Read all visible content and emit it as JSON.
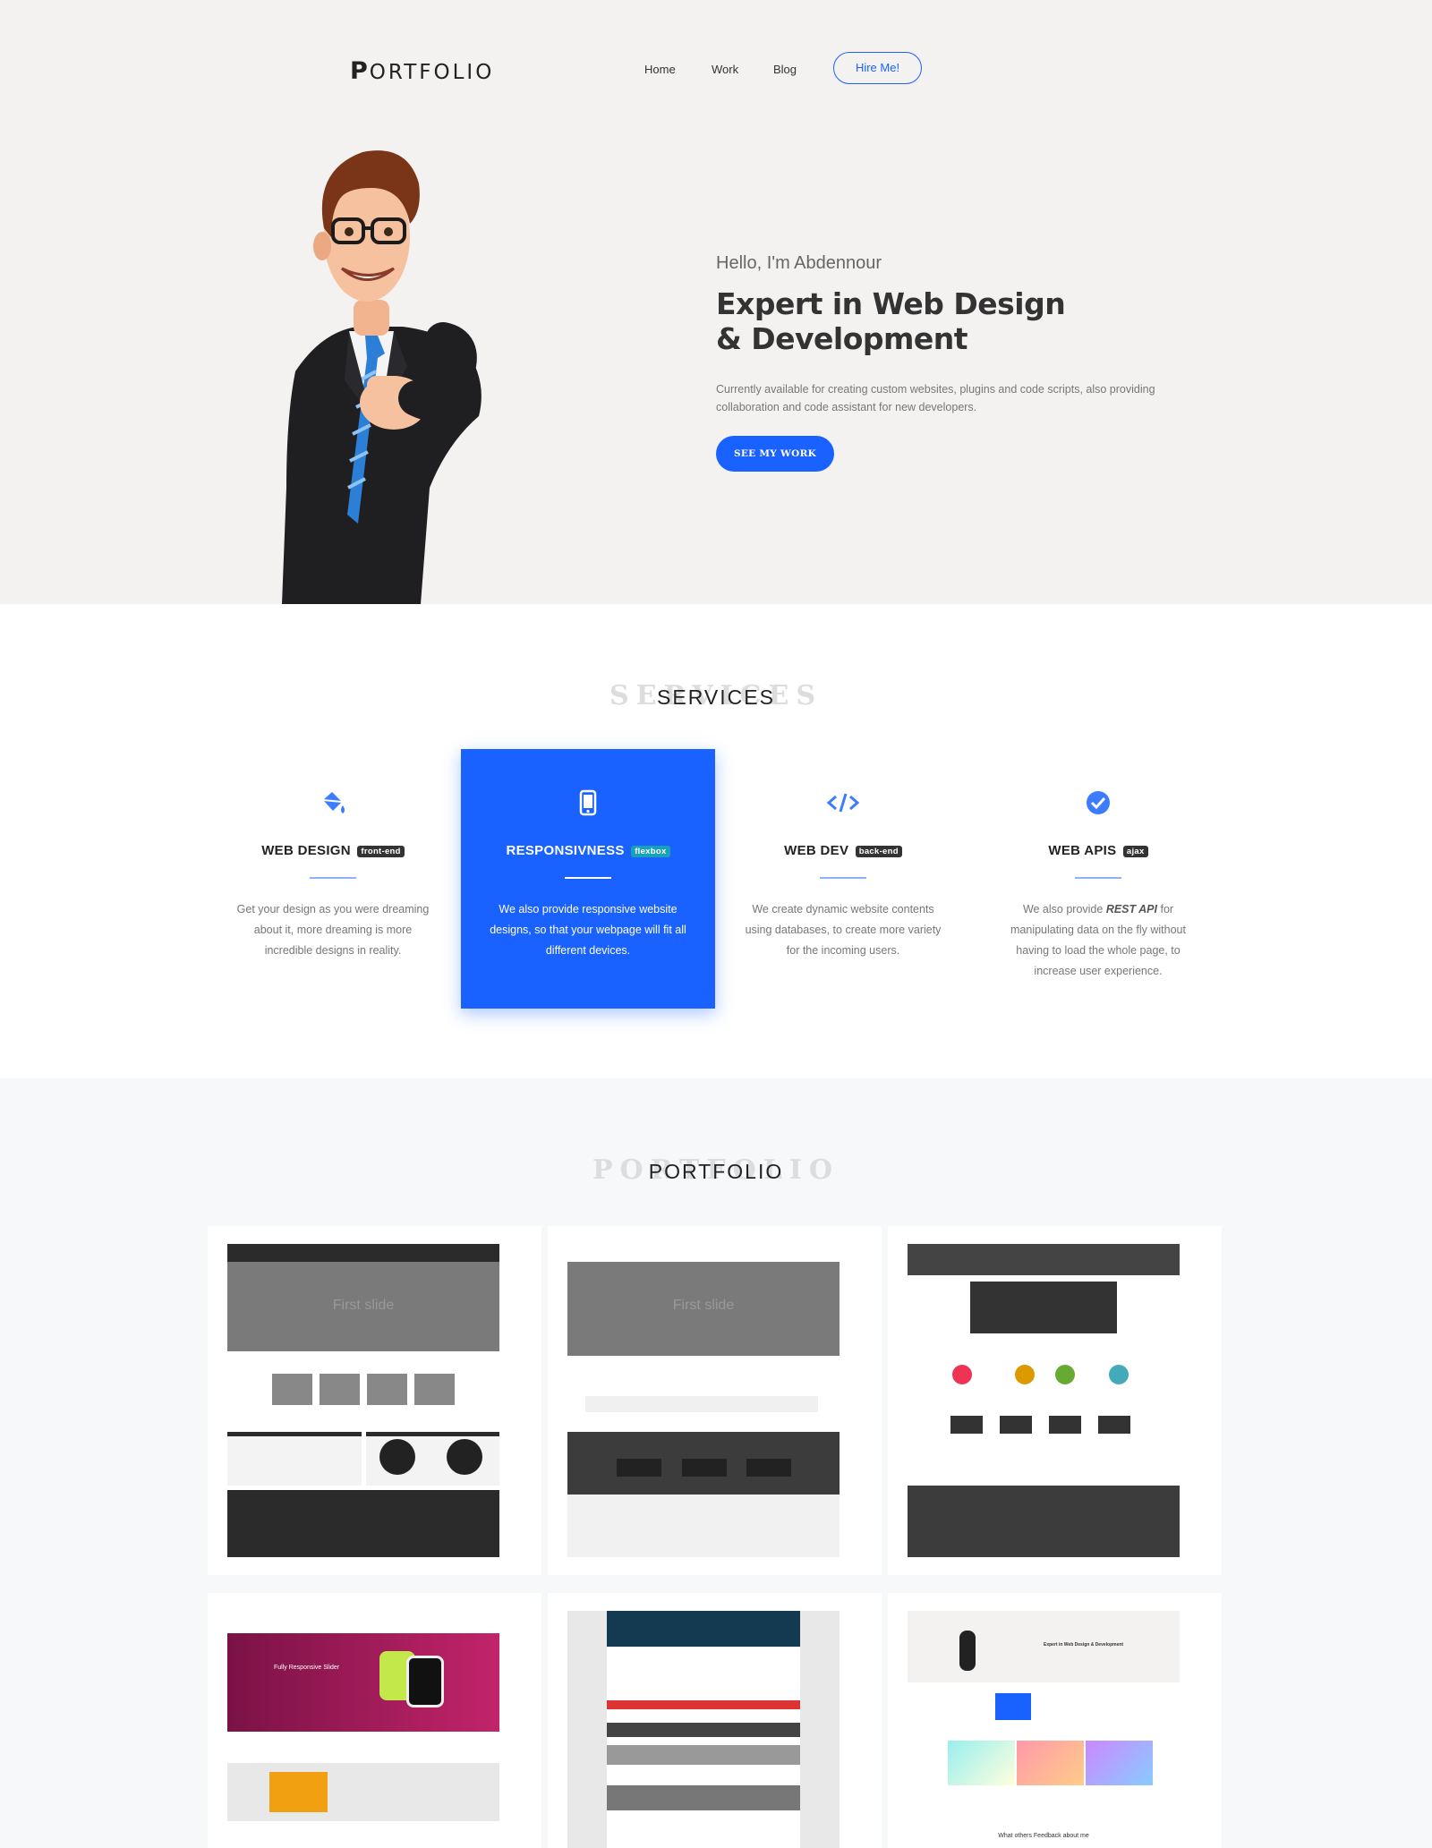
{
  "header": {
    "logo_first": "P",
    "logo_rest": "ORTFOLIO",
    "nav": [
      {
        "label": "Home"
      },
      {
        "label": "Work"
      },
      {
        "label": "Blog"
      }
    ],
    "hire_label": "Hire Me!"
  },
  "hero": {
    "hello": "Hello, I'm Abdennour",
    "headline": "Expert in Web Design & Development",
    "lead": "Currently available for creating custom websites, plugins and code scripts, also providing collaboration and code assistant for new developers.",
    "cta": "SEE MY WORK"
  },
  "services": {
    "ghost_title": "SERVICES",
    "title": "SERVICES",
    "items": [
      {
        "title": "WEB DESIGN",
        "badge": "front-end",
        "icon": "paint-bucket-icon",
        "desc": "Get your design as you were dreaming about it, more dreaming is more incredible designs in reality."
      },
      {
        "title": "RESPONSIVNESS",
        "badge": "flexbox",
        "icon": "mobile-phone-icon",
        "desc": "We also provide responsive website designs, so that your webpage will fit all different devices."
      },
      {
        "title": "WEB DEV",
        "badge": "back-end",
        "icon": "code-icon",
        "desc": "We create dynamic website contents using databases, to create more variety for the incoming users."
      },
      {
        "title": "WEB APIS",
        "badge": "ajax",
        "icon": "check-circle-icon",
        "desc_pre": "We also provide ",
        "desc_em": "REST API",
        "desc_post": " for manipulating data on the fly without having to load the whole page, to increase user experience."
      }
    ]
  },
  "portfolio": {
    "ghost_title": "PORTFOLIO",
    "title": "PORTFOLIO",
    "slide_label_1": "First slide",
    "slide_label_2": "First slide",
    "watch_slider_title": "Fully Responsive Slider",
    "mini_site_headline": "Expert in Web Design & Development",
    "mini_feedback": "What others Feedback about me"
  },
  "colors": {
    "accent": "#1a62ff",
    "hero_bg": "#f3f2f1",
    "portfolio_bg": "#f7f8fa"
  }
}
